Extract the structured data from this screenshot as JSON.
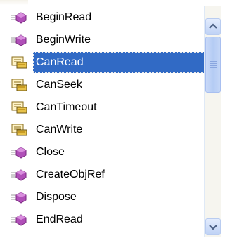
{
  "members": [
    {
      "label": "BeginRead",
      "icon": "method-icon",
      "selected": false
    },
    {
      "label": "BeginWrite",
      "icon": "method-icon",
      "selected": false
    },
    {
      "label": "CanRead",
      "icon": "property-icon",
      "selected": true
    },
    {
      "label": "CanSeek",
      "icon": "property-icon",
      "selected": false
    },
    {
      "label": "CanTimeout",
      "icon": "property-icon",
      "selected": false
    },
    {
      "label": "CanWrite",
      "icon": "property-icon",
      "selected": false
    },
    {
      "label": "Close",
      "icon": "method-icon",
      "selected": false
    },
    {
      "label": "CreateObjRef",
      "icon": "method-icon",
      "selected": false
    },
    {
      "label": "Dispose",
      "icon": "method-icon",
      "selected": false
    },
    {
      "label": "EndRead",
      "icon": "method-icon",
      "selected": false
    }
  ],
  "colors": {
    "selection": "#316ac5",
    "method_purple": "#b04fb8",
    "property_yellow": "#e7c24a",
    "scrollbar_blue": "#c1d3f7"
  },
  "scroll": {
    "position": 0
  }
}
